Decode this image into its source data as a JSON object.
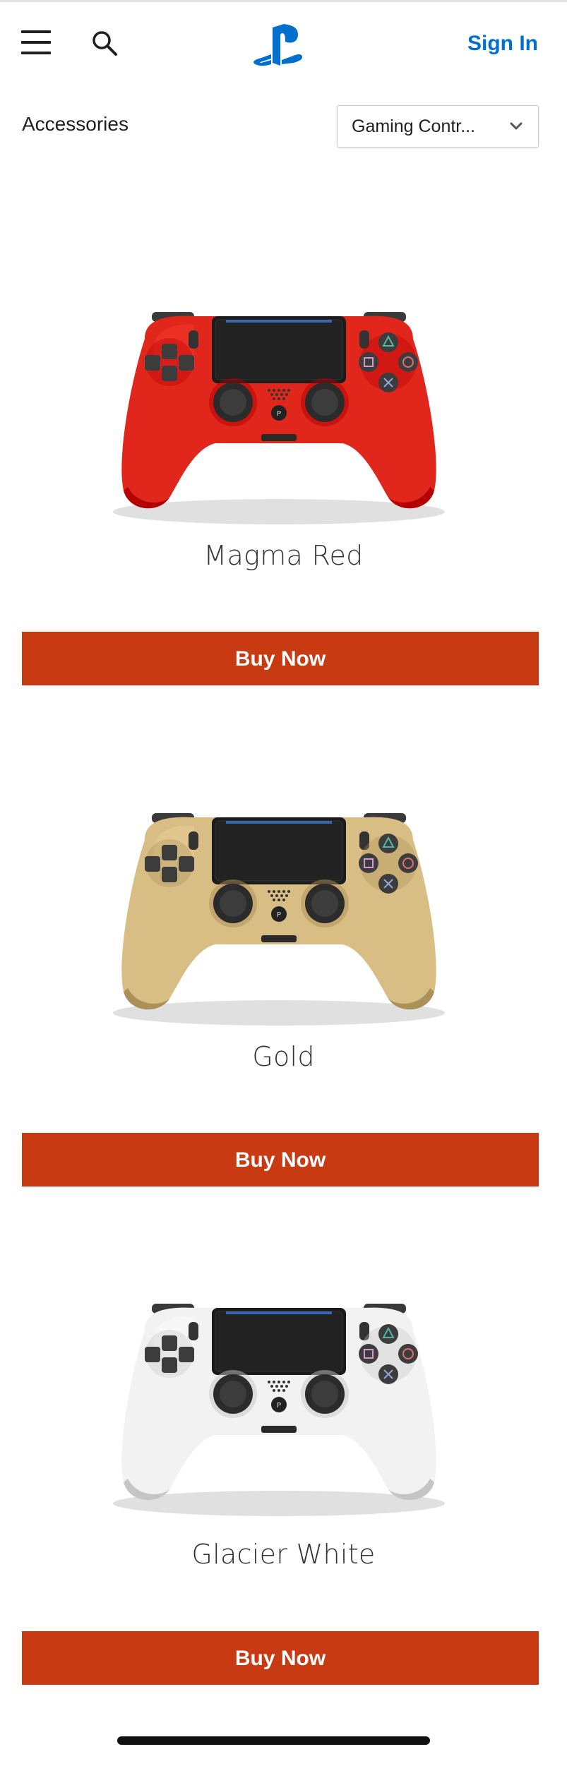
{
  "header": {
    "menu_icon": "hamburger-menu-icon",
    "search_icon": "search-icon",
    "logo": "playstation-logo",
    "sign_in": "Sign In",
    "brand_color": "#0070cc"
  },
  "subheader": {
    "breadcrumb": "Accessories",
    "category_select": {
      "selected": "Gaming Contr...",
      "icon": "chevron-down-icon"
    }
  },
  "products": [
    {
      "name": "Magma Red",
      "color": "#e1261c",
      "buy_label": "Buy Now"
    },
    {
      "name": "Gold",
      "color": "#d8bd84",
      "buy_label": "Buy Now"
    },
    {
      "name": "Glacier White",
      "color": "#f2f2f2",
      "buy_label": "Buy Now"
    }
  ],
  "colors": {
    "buy_button": "#c83b12",
    "accent": "#0070cc"
  }
}
